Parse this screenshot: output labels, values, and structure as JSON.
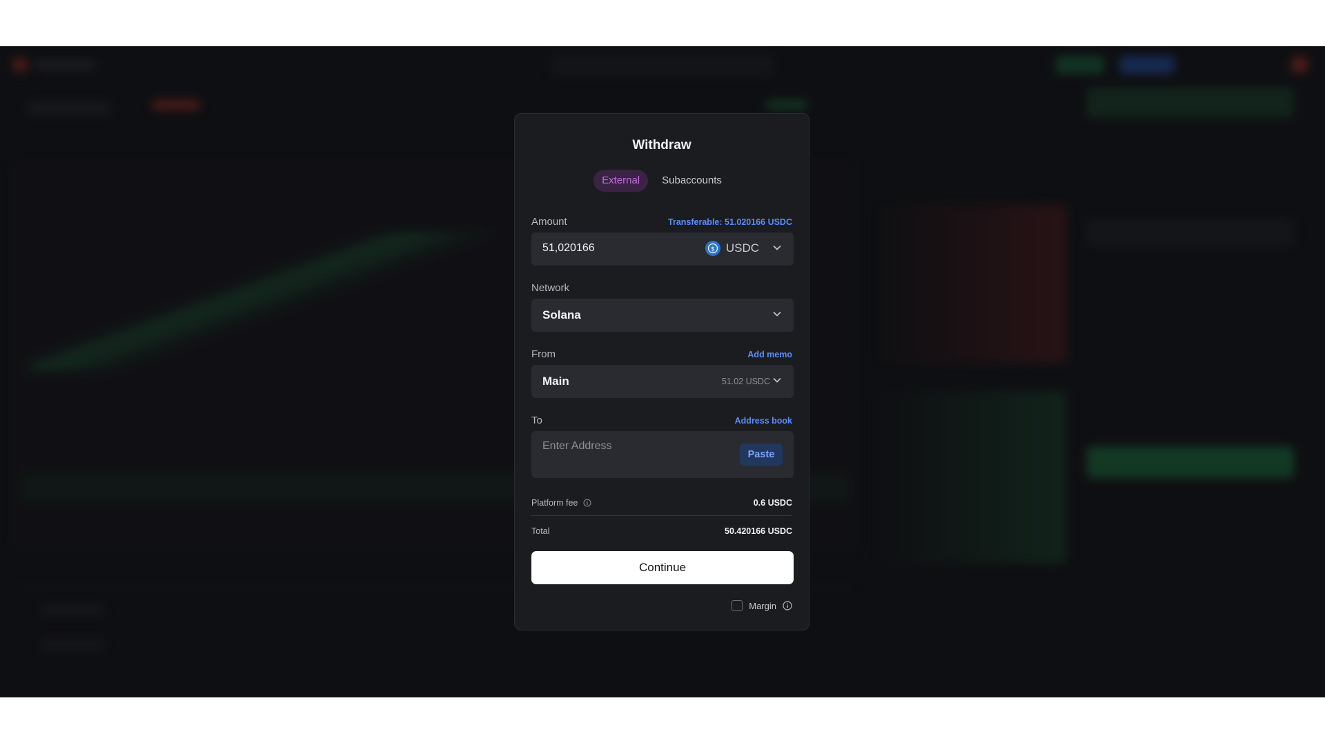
{
  "modal": {
    "title": "Withdraw",
    "tabs": [
      {
        "label": "External",
        "active": true
      },
      {
        "label": "Subaccounts",
        "active": false
      }
    ],
    "amount": {
      "label": "Amount",
      "transferable": "Transferable: 51.020166 USDC",
      "value": "51,020166",
      "token": "USDC",
      "token_icon": "usdc-coin-icon"
    },
    "network": {
      "label": "Network",
      "value": "Solana"
    },
    "from": {
      "label": "From",
      "action": "Add memo",
      "value": "Main",
      "balance": "51.02 USDC"
    },
    "to": {
      "label": "To",
      "action": "Address book",
      "placeholder": "Enter Address",
      "paste_label": "Paste"
    },
    "fees": {
      "platform_fee_label": "Platform fee",
      "platform_fee_value": "0.6 USDC",
      "total_label": "Total",
      "total_value": "50.420166 USDC"
    },
    "continue_label": "Continue",
    "margin_label": "Margin"
  },
  "colors": {
    "accent_blue": "#5b8dff",
    "tab_active": "#c86be6",
    "usdc": "#2775ca",
    "modal_bg": "#1b1c20"
  }
}
